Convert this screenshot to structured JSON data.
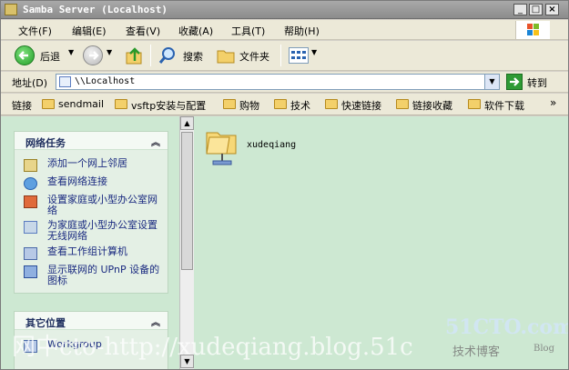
{
  "window": {
    "title": "Samba Server (Localhost)",
    "min_label": "_",
    "max_label": "□",
    "close_label": "×"
  },
  "menu": [
    {
      "label": "文件(F)"
    },
    {
      "label": "编辑(E)"
    },
    {
      "label": "查看(V)"
    },
    {
      "label": "收藏(A)"
    },
    {
      "label": "工具(T)"
    },
    {
      "label": "帮助(H)"
    }
  ],
  "toolbar": {
    "back_label": "后退",
    "search_label": "搜索",
    "folders_label": "文件夹"
  },
  "address": {
    "label": "地址(D)",
    "value": "\\\\Localhost",
    "go_label": "转到"
  },
  "links": {
    "label": "链接",
    "items": [
      {
        "label": "sendmail"
      },
      {
        "label": "vsftp安装与配置"
      },
      {
        "label": "购物"
      },
      {
        "label": "技术"
      },
      {
        "label": "快速链接"
      },
      {
        "label": "链接收藏"
      },
      {
        "label": "软件下载"
      }
    ]
  },
  "network_tasks": {
    "title": "网络任务",
    "items": [
      {
        "label": "添加一个网上邻居",
        "icon": "add-network-place-icon"
      },
      {
        "label": "查看网络连接",
        "icon": "network-connections-icon"
      },
      {
        "label": "设置家庭或小型办公室网络",
        "icon": "home-network-icon"
      },
      {
        "label": "为家庭或小型办公室设置无线网络",
        "icon": "wireless-network-icon"
      },
      {
        "label": "查看工作组计算机",
        "icon": "workgroup-computers-icon"
      },
      {
        "label": "显示联网的 UPnP 设备的图标",
        "icon": "upnp-devices-icon"
      }
    ]
  },
  "other_places": {
    "title": "其它位置",
    "items": [
      {
        "label": "Workgroup"
      }
    ]
  },
  "shares": [
    {
      "label": "xudeqiang",
      "icon": "shared-folder-icon"
    }
  ],
  "watermark": {
    "text": "网中cto-http://xudeqiang.blog.51c",
    "brand": "51CTO.com",
    "brand_sub": "技术博客",
    "brand_tag": "Blog"
  },
  "colors": {
    "content_bg": "#cde8d2",
    "link_text": "#1a2a80",
    "panel_title": "#1e2e5e"
  }
}
